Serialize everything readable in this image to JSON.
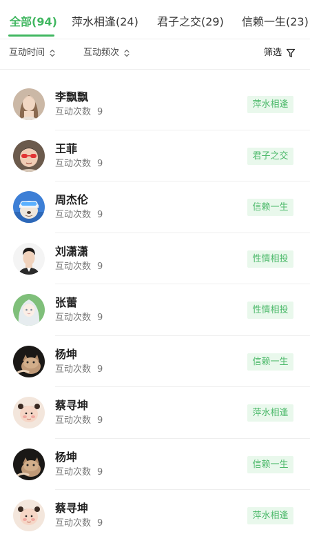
{
  "tabs": [
    {
      "label": "全部(94)",
      "active": true
    },
    {
      "label": "萍水相逢(24)",
      "active": false
    },
    {
      "label": "君子之交(29)",
      "active": false
    },
    {
      "label": "信赖一生(23)",
      "active": false
    }
  ],
  "toolbar": {
    "sort_time": "互动时间",
    "sort_freq": "互动频次",
    "filter": "筛选"
  },
  "colors": {
    "accent": "#3fb65f",
    "tag_bg": "#e9f8ec",
    "tag_text": "#4cb96a"
  },
  "contacts": [
    {
      "name": "李飘飘",
      "count_label": "互动次数",
      "count": "9",
      "tag": "萍水相逢",
      "avatar": "avatar-woman-icon"
    },
    {
      "name": "王菲",
      "count_label": "互动次数",
      "count": "9",
      "tag": "君子之交",
      "avatar": "avatar-child-sunglasses-icon"
    },
    {
      "name": "周杰伦",
      "count_label": "互动次数",
      "count": "9",
      "tag": "信赖一生",
      "avatar": "avatar-dog-goggles-icon"
    },
    {
      "name": "刘潇潇",
      "count_label": "互动次数",
      "count": "9",
      "tag": "性情相投",
      "avatar": "avatar-man-icon"
    },
    {
      "name": "张蕾",
      "count_label": "互动次数",
      "count": "9",
      "tag": "性情相投",
      "avatar": "avatar-anime-girl-icon"
    },
    {
      "name": "杨坤",
      "count_label": "互动次数",
      "count": "9",
      "tag": "信赖一生",
      "avatar": "avatar-cat-icon"
    },
    {
      "name": "蔡寻坤",
      "count_label": "互动次数",
      "count": "9",
      "tag": "萍水相逢",
      "avatar": "avatar-baby-icon"
    },
    {
      "name": "杨坤",
      "count_label": "互动次数",
      "count": "9",
      "tag": "信赖一生",
      "avatar": "avatar-cat-icon"
    },
    {
      "name": "蔡寻坤",
      "count_label": "互动次数",
      "count": "9",
      "tag": "萍水相逢",
      "avatar": "avatar-baby-icon"
    }
  ]
}
